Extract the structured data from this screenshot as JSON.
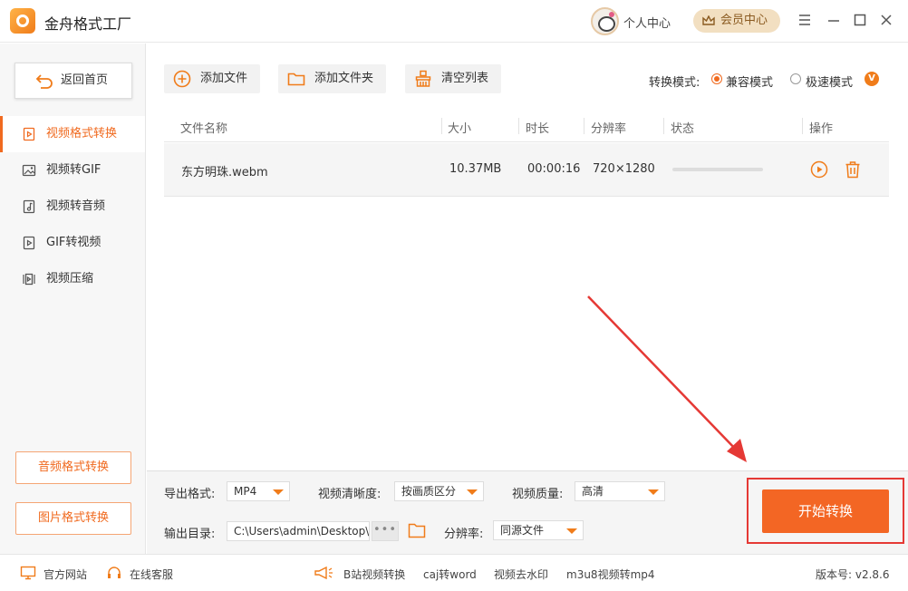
{
  "titlebar": {
    "app_title": "金舟格式工厂",
    "personal_center": "个人中心",
    "vip_center": "会员中心"
  },
  "sidebar": {
    "back_home": "返回首页",
    "items": [
      {
        "label": "视频格式转换",
        "icon": "video-file-icon",
        "active": true
      },
      {
        "label": "视频转GIF",
        "icon": "image-icon",
        "active": false
      },
      {
        "label": "视频转音频",
        "icon": "music-file-icon",
        "active": false
      },
      {
        "label": "GIF转视频",
        "icon": "video-file-icon",
        "active": false
      },
      {
        "label": "视频压缩",
        "icon": "compress-icon",
        "active": false
      }
    ],
    "audio_convert": "音频格式转换",
    "image_convert": "图片格式转换"
  },
  "toolbar": {
    "add_file": "添加文件",
    "add_folder": "添加文件夹",
    "clear_list": "清空列表",
    "mode_label": "转换模式:",
    "mode_compat": "兼容模式",
    "mode_fast": "极速模式",
    "mode_selected": "兼容模式",
    "v_badge": "V"
  },
  "table": {
    "headers": {
      "name": "文件名称",
      "size": "大小",
      "duration": "时长",
      "resolution": "分辨率",
      "status": "状态",
      "action": "操作"
    },
    "rows": [
      {
        "name": "东方明珠.webm",
        "size": "10.37MB",
        "duration": "00:00:16",
        "resolution": "720×1280",
        "progress": 0
      }
    ]
  },
  "settings": {
    "export_format_label": "导出格式:",
    "export_format_value": "MP4",
    "clarity_label": "视频清晰度:",
    "clarity_value": "按画质区分",
    "quality_label": "视频质量:",
    "quality_value": "高清",
    "output_dir_label": "输出目录:",
    "output_dir_value": "C:\\Users\\admin\\Desktop\\",
    "dots": "•••",
    "resolution_label": "分辨率:",
    "resolution_value": "同源文件",
    "start_button": "开始转换"
  },
  "footer": {
    "website": "官方网站",
    "support": "在线客服",
    "bilibili": "B站视频转换",
    "caj": "caj转word",
    "watermark": "视频去水印",
    "m3u8": "m3u8视频转mp4",
    "version": "版本号: v2.8.6"
  },
  "colors": {
    "accent": "#f06a1f",
    "start_button": "#f36624",
    "annotation_red": "#e53935"
  }
}
